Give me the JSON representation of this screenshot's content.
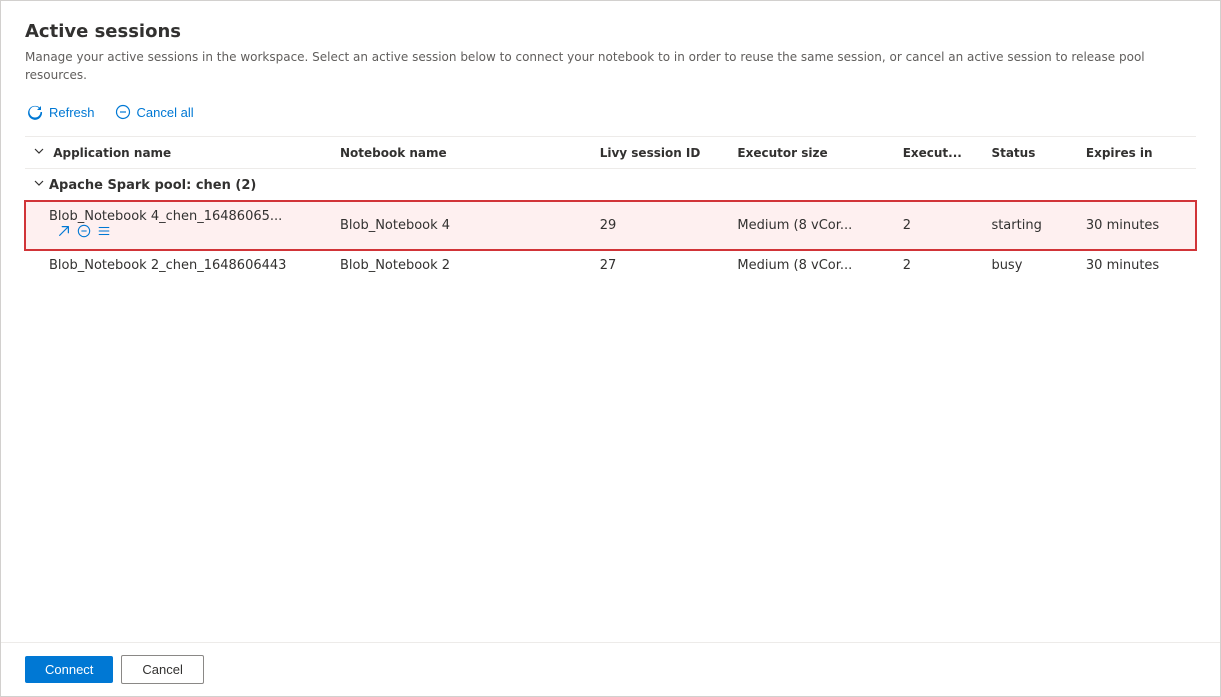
{
  "page": {
    "title": "Active sessions",
    "description": "Manage your active sessions in the workspace. Select an active session below to connect your notebook to in order to reuse the same session, or cancel an active session to release pool resources."
  },
  "toolbar": {
    "refresh_label": "Refresh",
    "cancel_all_label": "Cancel all"
  },
  "table": {
    "columns": [
      {
        "id": "app_name",
        "label": "Application name"
      },
      {
        "id": "notebook_name",
        "label": "Notebook name"
      },
      {
        "id": "livy_session_id",
        "label": "Livy session ID"
      },
      {
        "id": "executor_size",
        "label": "Executor size"
      },
      {
        "id": "executor_count",
        "label": "Execut..."
      },
      {
        "id": "status",
        "label": "Status"
      },
      {
        "id": "expires_in",
        "label": "Expires in"
      }
    ],
    "groups": [
      {
        "id": "group1",
        "label": "Apache Spark pool: chen (2)",
        "rows": [
          {
            "id": "row1",
            "app_name": "Blob_Notebook 4_chen_16486065...",
            "notebook_name": "Blob_Notebook 4",
            "livy_session_id": "29",
            "executor_size": "Medium (8 vCor...",
            "executor_count": "2",
            "status": "starting",
            "expires_in": "30 minutes",
            "selected": true
          },
          {
            "id": "row2",
            "app_name": "Blob_Notebook 2_chen_1648606443",
            "notebook_name": "Blob_Notebook 2",
            "livy_session_id": "27",
            "executor_size": "Medium (8 vCor...",
            "executor_count": "2",
            "status": "busy",
            "expires_in": "30 minutes",
            "selected": false
          }
        ]
      }
    ]
  },
  "footer": {
    "connect_label": "Connect",
    "cancel_label": "Cancel"
  }
}
